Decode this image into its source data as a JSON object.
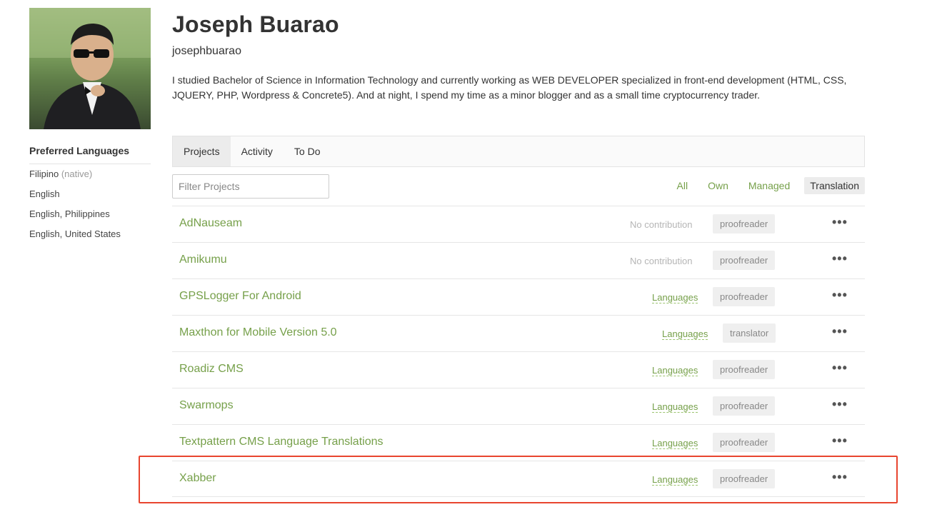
{
  "profile": {
    "name": "Joseph Buarao",
    "username": "josephbuarao",
    "bio": "I studied Bachelor of Science in Information Technology and currently working as WEB DEVELOPER specialized in front-end development (HTML, CSS, JQUERY, PHP, Wordpress & Concrete5). And at night, I spend my time as a minor blogger and as a small time cryptocurrency trader."
  },
  "sidebar": {
    "title": "Preferred Languages",
    "languages": [
      {
        "label": "Filipino",
        "note": "(native)"
      },
      {
        "label": "English",
        "note": ""
      },
      {
        "label": "English, Philippines",
        "note": ""
      },
      {
        "label": "English, United States",
        "note": ""
      }
    ]
  },
  "tabs": [
    "Projects",
    "Activity",
    "To Do"
  ],
  "active_tab": "Projects",
  "filter": {
    "placeholder": "Filter Projects"
  },
  "filters": [
    "All",
    "Own",
    "Managed",
    "Translation"
  ],
  "active_filter": "Translation",
  "projects": [
    {
      "name": "AdNauseam",
      "contribution": "No contribution",
      "role": "proofreader"
    },
    {
      "name": "Amikumu",
      "contribution": "No contribution",
      "role": "proofreader"
    },
    {
      "name": "GPSLogger For Android",
      "contribution": "Languages",
      "role": "proofreader"
    },
    {
      "name": "Maxthon for Mobile Version 5.0",
      "contribution": "Languages",
      "role": "translator"
    },
    {
      "name": "Roadiz CMS",
      "contribution": "Languages",
      "role": "proofreader"
    },
    {
      "name": "Swarmops",
      "contribution": "Languages",
      "role": "proofreader"
    },
    {
      "name": "Textpattern CMS Language Translations",
      "contribution": "Languages",
      "role": "proofreader"
    },
    {
      "name": "Xabber",
      "contribution": "Languages",
      "role": "proofreader"
    }
  ],
  "more_glyph": "•••",
  "colors": {
    "accent": "#76a04a",
    "highlight": "#e8452f"
  }
}
